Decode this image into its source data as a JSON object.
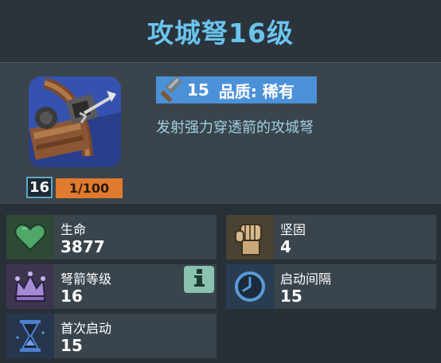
{
  "header": {
    "title": "攻城弩16级"
  },
  "item": {
    "level": "16",
    "xp": "1/100",
    "hammer_count": "15",
    "quality_label": "品质: 稀有",
    "description": "发射强力穿透箭的攻城弩"
  },
  "stats": [
    {
      "label": "生命",
      "value": "3877",
      "icon": "heart-icon"
    },
    {
      "label": "坚固",
      "value": "4",
      "icon": "fist-icon"
    },
    {
      "label": "弩箭等级",
      "value": "16",
      "icon": "crown-icon"
    },
    {
      "label": "启动间隔",
      "value": "15",
      "icon": "clock-icon"
    },
    {
      "label": "首次启动",
      "value": "15",
      "icon": "hourglass-icon"
    }
  ],
  "colors": {
    "title": "#6ac4ee",
    "quality_badge": "#4b91d8",
    "xp_bar": "#e07a2f",
    "description": "#9fd0e1",
    "info_button": "#8ac1b1"
  }
}
